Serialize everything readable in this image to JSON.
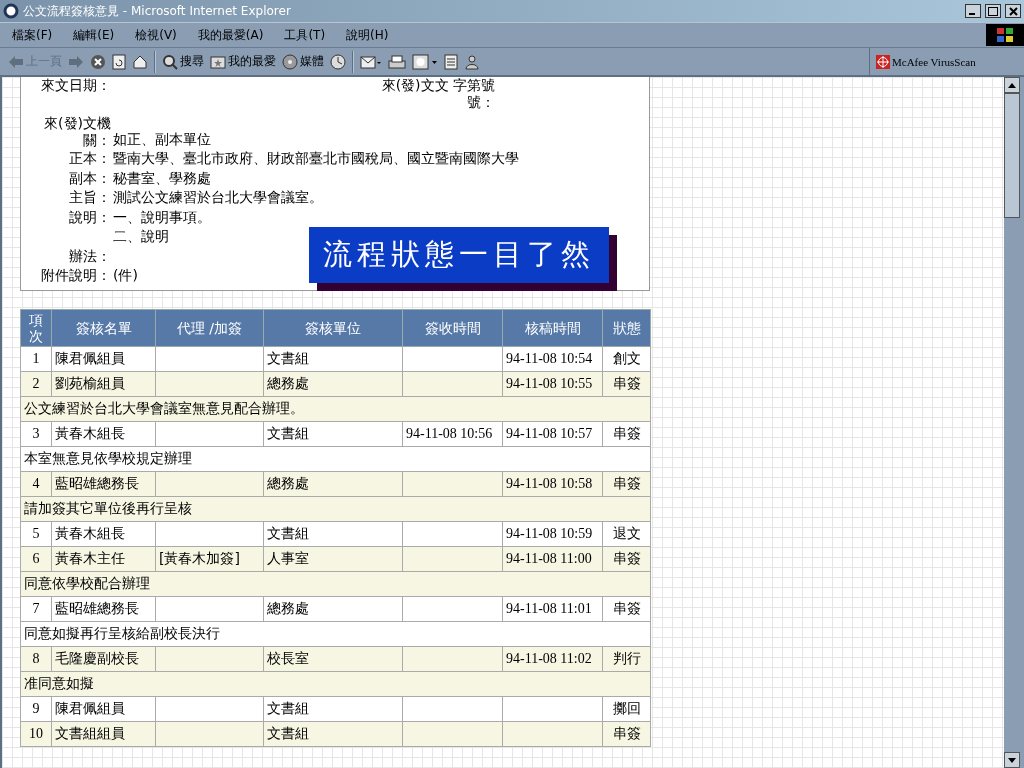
{
  "window": {
    "title": "公文流程簽核意見 - Microsoft Internet Explorer"
  },
  "menu": [
    "檔案(F)",
    "編輯(E)",
    "檢視(V)",
    "我的最愛(A)",
    "工具(T)",
    "說明(H)"
  ],
  "toolbar": [
    {
      "kind": "back",
      "label": "上一頁",
      "disabled": true
    },
    {
      "kind": "forward",
      "disabled": true
    },
    {
      "kind": "stop"
    },
    {
      "kind": "refresh"
    },
    {
      "kind": "home"
    },
    {
      "kind": "sep"
    },
    {
      "kind": "search",
      "label": "搜尋"
    },
    {
      "kind": "favorites",
      "label": "我的最愛"
    },
    {
      "kind": "media",
      "label": "媒體"
    },
    {
      "kind": "history"
    },
    {
      "kind": "sep"
    },
    {
      "kind": "mail"
    },
    {
      "kind": "print"
    },
    {
      "kind": "edit"
    },
    {
      "kind": "discuss"
    },
    {
      "kind": "messenger"
    }
  ],
  "addon": {
    "label": "McAfee VirusScan"
  },
  "document": {
    "top_fields": [
      {
        "label": [
          "來文日期："
        ]
      },
      {
        "label": [
          "來(發)文文 字第號",
          "號："
        ]
      }
    ],
    "fields": [
      {
        "label": [
          "來(發)文機",
          "關："
        ],
        "value": [
          "如正、副本單位"
        ]
      },
      {
        "label": [
          "正本："
        ],
        "value": [
          "暨南大學、臺北市政府、財政部臺北市國稅局、國立暨南國際大學"
        ]
      },
      {
        "label": [
          "副本："
        ],
        "value": [
          "秘書室、學務處"
        ]
      },
      {
        "label": [
          "主旨："
        ],
        "value": [
          "測試公文練習於台北大學會議室。"
        ]
      },
      {
        "label": [
          "說明："
        ],
        "value": [
          "一、說明事項。",
          "二、說明"
        ]
      },
      {
        "label": [
          "辦法："
        ]
      },
      {
        "label": [
          "附件說明："
        ],
        "value": [
          "(件)"
        ]
      }
    ],
    "banner": "流程狀態一目了然"
  },
  "table": {
    "columns": [
      [
        "項",
        "次"
      ],
      "簽核名單",
      "代理 /加簽",
      "簽核單位",
      "簽收時間",
      "核稿時間",
      "狀態"
    ],
    "rows": [
      {
        "no": "1",
        "name": "陳君佩組員",
        "proxy": "",
        "unit": "文書組",
        "received": "",
        "reviewed": "94-11-08 10:54",
        "status": "創文"
      },
      {
        "no": "2",
        "name": "劉苑榆組員",
        "proxy": "",
        "unit": "總務處",
        "received": "",
        "reviewed": "94-11-08 10:55",
        "status": "串簽",
        "comment": "公文練習於台北大學會議室無意見配合辦理。"
      },
      {
        "no": "3",
        "name": "黃春木組長",
        "proxy": "",
        "unit": "文書組",
        "received": "94-11-08 10:56",
        "reviewed": "94-11-08 10:57",
        "status": "串簽",
        "comment": "本室無意見依學校規定辦理"
      },
      {
        "no": "4",
        "name": "藍昭雄總務長",
        "proxy": "",
        "unit": "總務處",
        "received": "",
        "reviewed": "94-11-08 10:58",
        "status": "串簽",
        "comment": "請加簽其它單位後再行呈核"
      },
      {
        "no": "5",
        "name": "黃春木組長",
        "proxy": "",
        "unit": "文書組",
        "received": "",
        "reviewed": "94-11-08 10:59",
        "status": "退文"
      },
      {
        "no": "6",
        "name": "黃春木主任",
        "proxy": "[黃春木加簽]",
        "unit": "人事室",
        "received": "",
        "reviewed": "94-11-08 11:00",
        "status": "串簽",
        "comment": "同意依學校配合辦理"
      },
      {
        "no": "7",
        "name": "藍昭雄總務長",
        "proxy": "",
        "unit": "總務處",
        "received": "",
        "reviewed": "94-11-08 11:01",
        "status": "串簽",
        "comment": "同意如擬再行呈核給副校長決行"
      },
      {
        "no": "8",
        "name": "毛隆慶副校長",
        "proxy": "",
        "unit": "校長室",
        "received": "",
        "reviewed": "94-11-08 11:02",
        "status": "判行",
        "comment": "准同意如擬"
      },
      {
        "no": "9",
        "name": "陳君佩組員",
        "proxy": "",
        "unit": "文書組",
        "received": "",
        "reviewed": "",
        "status": "擲回"
      },
      {
        "no": "10",
        "name": "文書組組員",
        "proxy": "",
        "unit": "文書組",
        "received": "",
        "reviewed": "",
        "status": "串簽"
      }
    ]
  }
}
